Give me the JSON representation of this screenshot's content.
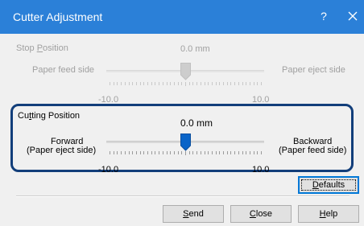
{
  "window": {
    "title": "Cutter Adjustment",
    "help_label": "?",
    "titlebar_color": "#2b80d8"
  },
  "stop_position": {
    "label_prefix": "Stop ",
    "label_hotkey": "P",
    "label_suffix": "osition",
    "value": "0.0",
    "unit": "mm",
    "left_label": "Paper feed side",
    "right_label": "Paper eject side",
    "min_label": "-10.0",
    "max_label": "10.0",
    "slider_value": 0.0,
    "slider_min": -10.0,
    "slider_max": 10.0,
    "enabled": false
  },
  "cutting_position": {
    "label_prefix": "Cu",
    "label_hotkey": "t",
    "label_suffix": "ting Position",
    "value": "0.0",
    "unit": "mm",
    "left_label_line1": "Forward",
    "left_label_line2": "(Paper eject side)",
    "right_label_line1": "Backward",
    "right_label_line2": "(Paper feed side)",
    "min_label": "-10.0",
    "max_label": "10.0",
    "slider_value": 0.0,
    "slider_min": -10.0,
    "slider_max": 10.0,
    "thumb_color": "#0a64c8",
    "enabled": true,
    "highlight_color": "#123e7a"
  },
  "buttons": {
    "defaults_hotkey": "D",
    "defaults_rest": "efaults",
    "send_hotkey": "S",
    "send_rest": "end",
    "close_hotkey": "C",
    "close_rest": "lose",
    "help_hotkey": "H",
    "help_rest": "elp"
  }
}
